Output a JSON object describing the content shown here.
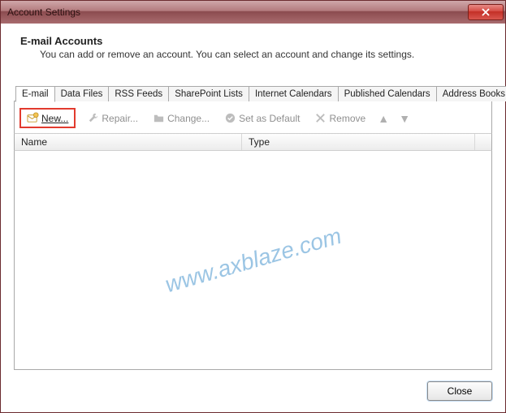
{
  "window": {
    "title": "Account Settings"
  },
  "header": {
    "title": "E-mail Accounts",
    "subtitle": "You can add or remove an account. You can select an account and change its settings."
  },
  "tabs": [
    {
      "label": "E-mail",
      "active": true
    },
    {
      "label": "Data Files"
    },
    {
      "label": "RSS Feeds"
    },
    {
      "label": "SharePoint Lists"
    },
    {
      "label": "Internet Calendars"
    },
    {
      "label": "Published Calendars"
    },
    {
      "label": "Address Books"
    }
  ],
  "toolbar": {
    "new_label": "New...",
    "repair_label": "Repair...",
    "change_label": "Change...",
    "default_label": "Set as Default",
    "remove_label": "Remove"
  },
  "columns": {
    "name": "Name",
    "type": "Type"
  },
  "watermark": "www.axblaze.com",
  "buttons": {
    "close": "Close"
  }
}
